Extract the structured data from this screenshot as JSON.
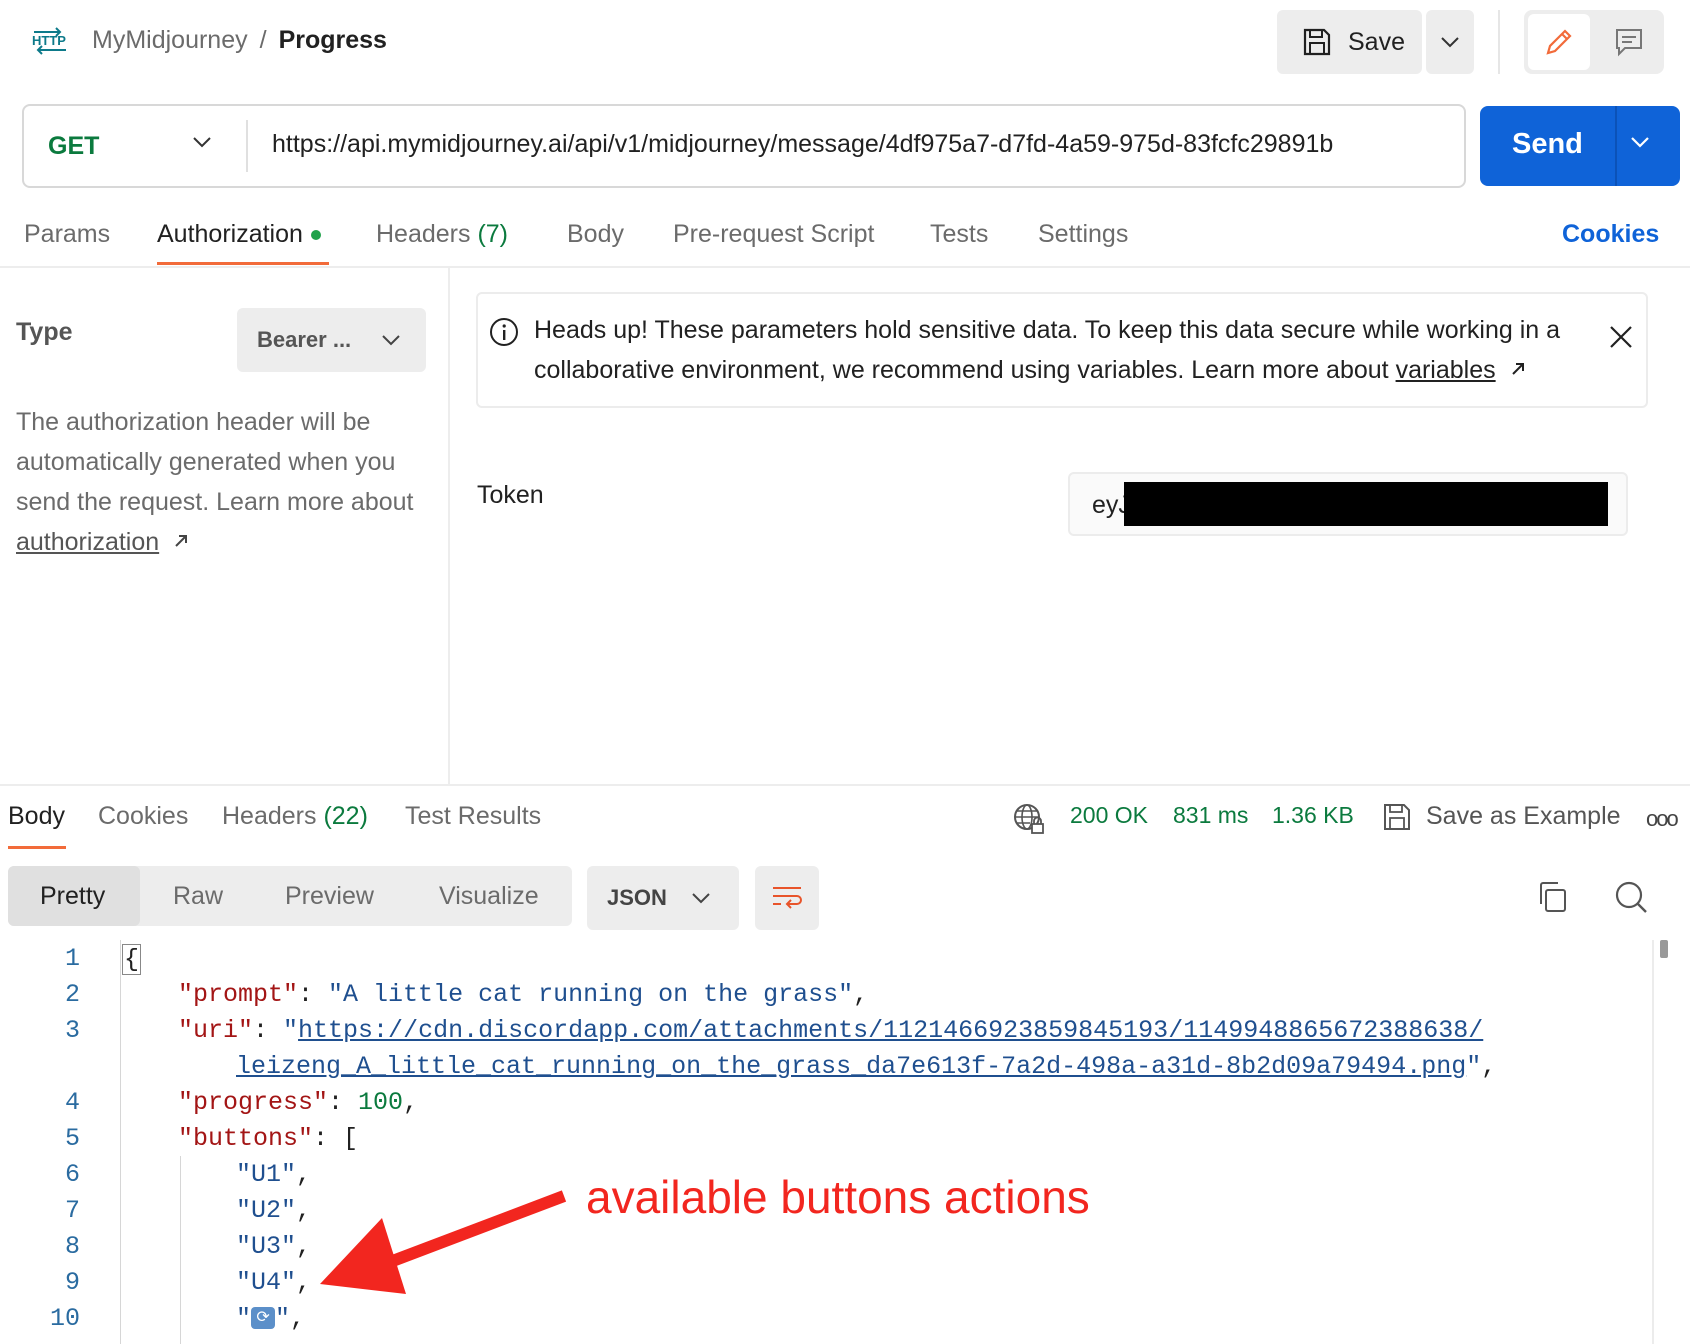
{
  "header": {
    "collection": "MyMidjourney",
    "separator": "/",
    "request_name": "Progress",
    "save_label": "Save",
    "badge_text": "HTTP"
  },
  "request": {
    "method": "GET",
    "url": "https://api.mymidjourney.ai/api/v1/midjourney/message/4df975a7-d7fd-4a59-975d-83fcfc29891b",
    "send_label": "Send"
  },
  "tabs": {
    "params": "Params",
    "authorization": "Authorization",
    "headers": "Headers",
    "headers_count": "(7)",
    "body": "Body",
    "pre_request": "Pre-request Script",
    "tests": "Tests",
    "settings": "Settings",
    "cookies": "Cookies"
  },
  "auth": {
    "type_label": "Type",
    "type_value": "Bearer ...",
    "desc_prefix": "The authorization header will be automatically generated when you send the request. Learn more about ",
    "desc_link": "authorization",
    "notice_prefix": "Heads up! These parameters hold sensitive data. To keep this data secure while working in a collaborative environment, we recommend using variables. Learn more about ",
    "notice_link": "variables",
    "token_label": "Token",
    "token_visible": "eyJ"
  },
  "response": {
    "tabs": {
      "body": "Body",
      "cookies": "Cookies",
      "headers": "Headers",
      "headers_count": "(22)",
      "test_results": "Test Results"
    },
    "status": "200 OK",
    "time": "831 ms",
    "size": "1.36 KB",
    "save_example": "Save as Example",
    "more": "ooo",
    "formats": [
      "Pretty",
      "Raw",
      "Preview",
      "Visualize"
    ],
    "language": "JSON"
  },
  "code": {
    "line_numbers": [
      "1",
      "2",
      "3",
      "4",
      "5",
      "6",
      "7",
      "8",
      "9",
      "10"
    ],
    "open_brace": "{",
    "prompt_key": "\"prompt\"",
    "prompt_val": "\"A little cat running on the grass\"",
    "uri_key": "\"uri\"",
    "uri_val_line1": "https://cdn.discordapp.com/attachments/1121466923859845193/1149948865672388638/",
    "uri_val_line2": "leizeng_A_little_cat_running_on_the_grass_da7e613f-7a2d-498a-a31d-8b2d09a79494.png",
    "progress_key": "\"progress\"",
    "progress_val": "100",
    "buttons_key": "\"buttons\"",
    "buttons": [
      "\"U1\"",
      "\"U2\"",
      "\"U3\"",
      "\"U4\""
    ],
    "refresh_glyph": "⟳"
  },
  "annotation": "available buttons actions",
  "colors": {
    "send_blue": "#0f63d8",
    "get_green": "#0b7a3e",
    "accent_orange": "#f26b3a",
    "annotation_red": "#f2261f"
  }
}
